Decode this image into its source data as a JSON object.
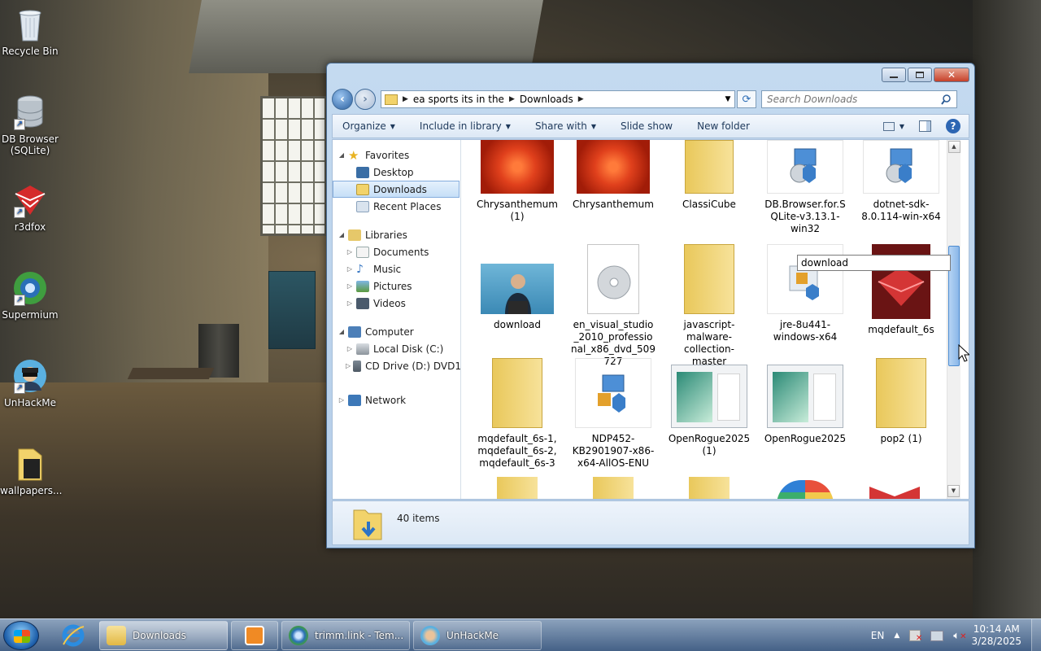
{
  "desktop_icons": [
    {
      "label": "Recycle Bin",
      "icon": "recycle-bin-icon"
    },
    {
      "label": "DB Browser (SQLite)",
      "icon": "database-icon"
    },
    {
      "label": "r3dfox",
      "icon": "r3dfox-icon"
    },
    {
      "label": "Supermium",
      "icon": "supermium-icon"
    },
    {
      "label": "UnHackMe",
      "icon": "unhackme-icon"
    },
    {
      "label": "wallpapers...",
      "icon": "folder-icon"
    }
  ],
  "window": {
    "breadcrumb": [
      "ea sports its in the",
      "Downloads"
    ],
    "search_placeholder": "Search Downloads",
    "toolbar": {
      "organize": "Organize",
      "include_in_library": "Include in library",
      "share_with": "Share with",
      "slide_show": "Slide show",
      "new_folder": "New folder"
    },
    "nav": {
      "favorites": "Favorites",
      "desktop": "Desktop",
      "downloads": "Downloads",
      "recent_places": "Recent Places",
      "libraries": "Libraries",
      "documents": "Documents",
      "music": "Music",
      "pictures": "Pictures",
      "videos": "Videos",
      "computer": "Computer",
      "local_disk": "Local Disk (C:)",
      "cd_drive": "CD Drive (D:) DVD1",
      "network": "Network"
    },
    "files": [
      {
        "name": "Chrysanthemum (1)",
        "icon": "image-thumbnail"
      },
      {
        "name": "Chrysanthemum",
        "icon": "image-thumbnail"
      },
      {
        "name": "ClassiCube",
        "icon": "zip-folder-icon"
      },
      {
        "name": "DB.Browser.for.SQLite-v3.13.1-win32",
        "icon": "installer-icon"
      },
      {
        "name": "dotnet-sdk-8.0.114-win-x64",
        "icon": "installer-icon"
      },
      {
        "name": "download",
        "icon": "image-thumbnail"
      },
      {
        "name": "en_visual_studio_2010_professional_x86_dvd_509727",
        "icon": "disc-image-icon"
      },
      {
        "name": "javascript-malware-collection-master",
        "icon": "zip-folder-icon"
      },
      {
        "name": "jre-8u441-windows-x64",
        "icon": "java-installer-icon"
      },
      {
        "name": "mqdefault_6s",
        "icon": "image-thumbnail"
      },
      {
        "name": "mqdefault_6s-1, mqdefault_6s-2, mqdefault_6s-3",
        "icon": "zip-folder-icon"
      },
      {
        "name": "NDP452-KB2901907-x86-x64-AllOS-ENU",
        "icon": "installer-icon"
      },
      {
        "name": "OpenRogue2025 (1)",
        "icon": "app-thumbnail"
      },
      {
        "name": "OpenRogue2025",
        "icon": "app-thumbnail"
      },
      {
        "name": "pop2 (1)",
        "icon": "zip-folder-icon"
      }
    ],
    "rename_tooltip": "download",
    "status_count": "40 items"
  },
  "taskbar": {
    "buttons": [
      {
        "label": "",
        "icon": "internet-explorer-icon"
      },
      {
        "label": "Downloads",
        "icon": "explorer-folder-icon"
      },
      {
        "label": "",
        "icon": "media-player-icon"
      },
      {
        "label": "trimm.link - Tem...",
        "icon": "supermium-icon"
      },
      {
        "label": "UnHackMe",
        "icon": "unhackme-icon"
      }
    ],
    "language": "EN",
    "time": "10:14 AM",
    "date": "3/28/2025"
  },
  "colors": {
    "selection": "#c6dff7",
    "accent": "#2d66b3",
    "chrysanthemum": "#e0401c",
    "folder": "#f2d36b"
  }
}
